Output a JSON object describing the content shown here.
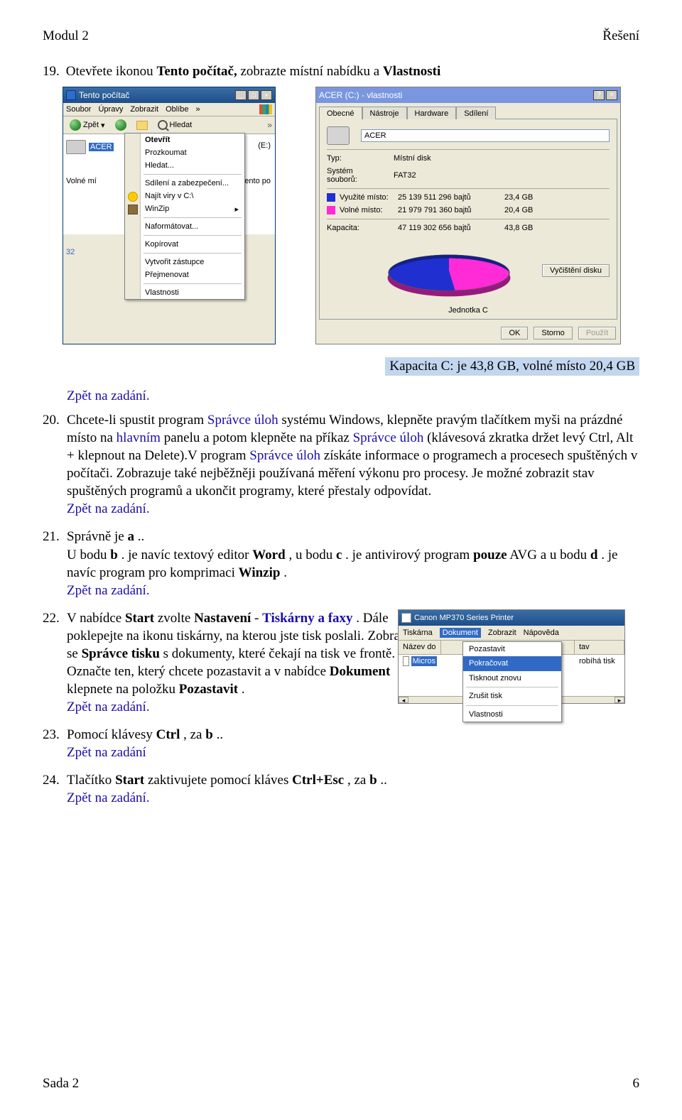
{
  "header": {
    "left": "Modul 2",
    "right": "Řešení"
  },
  "intro": {
    "num": "19.",
    "text_a": "Otevřete ikonou ",
    "bold_a": "Tento počítač,",
    "text_b": " zobrazte místní nabídku a ",
    "bold_b": "Vlastnosti"
  },
  "tpc": {
    "title": "Tento počítač",
    "menus": [
      "Soubor",
      "Úpravy",
      "Zobrazit",
      "Oblíbe"
    ],
    "menu_more": "»",
    "back": "Zpět",
    "search": "Hledat",
    "toolbar_more": "»",
    "drive_label": "ACER",
    "drive_suffix": "(E:)",
    "side_lines": [
      "Volné mí",
      "ento po"
    ],
    "bottom_left": "32",
    "context": {
      "open": "Otevřít",
      "explore": "Prozkoumat",
      "find": "Hledat...",
      "share": "Sdílení a zabezpečení...",
      "av": "Najít viry v C:\\",
      "winzip": "WinZip",
      "format": "Naformátovat...",
      "copy": "Kopírovat",
      "shortcut": "Vytvořit zástupce",
      "rename": "Přejmenovat",
      "props": "Vlastnosti"
    }
  },
  "prop": {
    "title": "ACER (C:) - vlastnosti",
    "tabs": [
      "Obecné",
      "Nástroje",
      "Hardware",
      "Sdílení"
    ],
    "name_value": "ACER",
    "rows": {
      "type_l": "Typ:",
      "type_v": "Místní disk",
      "fs_l": "Systém souborů:",
      "fs_v": "FAT32",
      "used_l": "Využité místo:",
      "used_b": "25 139 511 296 bajtů",
      "used_g": "23,4 GB",
      "free_l": "Volné místo:",
      "free_b": "21 979 791 360 bajtů",
      "free_g": "20,4 GB",
      "cap_l": "Kapacita:",
      "cap_b": "47 119 302 656 bajtů",
      "cap_g": "43,8 GB"
    },
    "unit": "Jednotka C",
    "cleanup": "Vyčištění disku",
    "ok": "OK",
    "cancel": "Storno",
    "apply": "Použít"
  },
  "capacity_highlight": "Kapacita C: je 43,8 GB, volné místo 20,4 GB",
  "items": {
    "i20": {
      "num": "20.",
      "p1a": "Chcete-li spustit program ",
      "p1b": "Správce úloh",
      "p1c": " systému Windows, klepněte pravým tlačítkem myši na prázdné místo na ",
      "p1d": "hlavním",
      "p1e": " panelu a potom klepněte na příkaz ",
      "p1f": "Správce úloh",
      "p1g": " (klávesová zkratka držet levý Ctrl, Alt + klepnout na Delete).V program ",
      "p1h": "Správce úloh",
      "p1i": " získáte informace o programech a procesech spuštěných v počítači. Zobrazuje také nejběžněji používaná měření výkonu pro procesy. Je možné zobrazit stav spuštěných programů a ukončit programy, které přestaly odpovídat.",
      "back": "Zpět na zadání."
    },
    "i21": {
      "num": "21.",
      "l1a": "Správně je ",
      "l1b": "a",
      "l1c": "..",
      "l2a": "U bodu ",
      "l2b": "b",
      "l2c": ". je navíc textový editor ",
      "l2d": "Word",
      "l2e": ", u bodu ",
      "l2f": "c",
      "l2g": ". je antivirový program ",
      "l2h": "pouze",
      "l2i": " AVG a u bodu ",
      "l2j": "d",
      "l2k": ". je navíc program pro komprimaci ",
      "l2l": "Winzip",
      "l2m": ".",
      "back": "Zpět na zadání."
    },
    "i22": {
      "num": "22.",
      "a": "V nabídce ",
      "b": "Start",
      "c": " zvolte ",
      "d": "Nastavení",
      "e": " - ",
      "f": "Tiskárny a faxy",
      "g": ". Dále poklepejte na ikonu tiskárny, na kterou jste tisk poslali. Zobrazí se ",
      "h": "Správce tisku",
      "i": " s dokumenty, které čekají na tisk ve frontě. Označte ten, který chcete pozastavit a v nabídce ",
      "j": "Dokument",
      "k": " klepnete na položku ",
      "l": "Pozastavit",
      "m": ".",
      "back": "Zpět na zadání."
    },
    "i23": {
      "num": "23.",
      "a": "Pomocí klávesy ",
      "b": "Ctrl",
      "c": ", za ",
      "d": "b",
      "e": "..",
      "back": "Zpět na zadání"
    },
    "i24": {
      "num": "24.",
      "a": "Tlačítko ",
      "b": "Start",
      "c": " zaktivujete pomocí kláves ",
      "d": "Ctrl+Esc",
      "e": ", za ",
      "f": "b",
      "g": "..",
      "back": "Zpět na zadání."
    }
  },
  "printer": {
    "title": "Canon MP370 Series Printer",
    "menu": [
      "Tiskárna",
      "Dokument",
      "Zobrazit",
      "Nápověda"
    ],
    "col1": "Název do",
    "col_last": "tav",
    "row1_name": "Micros",
    "row1_state": "robíhá tisk",
    "ctx": {
      "pause": "Pozastavit",
      "continue": "Pokračovat",
      "restart": "Tisknout znovu",
      "cancel": "Zrušit tisk",
      "props": "Vlastnosti"
    }
  },
  "footer": {
    "left": "Sada 2",
    "right": "6"
  }
}
